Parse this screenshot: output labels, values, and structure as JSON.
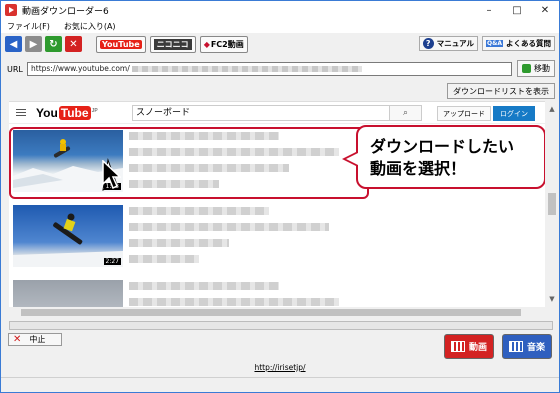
{
  "window": {
    "title": "動画ダウンローダー6",
    "controls": {
      "minimize": "–",
      "maximize": "□",
      "close": "✕"
    }
  },
  "menu": {
    "items": [
      "ファイル(F)",
      "お気に入り(A)"
    ]
  },
  "toolbar": {
    "site_buttons": [
      "YouTube",
      "ニコニコ",
      "FC2動画"
    ],
    "manual_label": "マニュアル",
    "faq_label": "よくある質問",
    "faq_badge": "Q&A"
  },
  "url_bar": {
    "label": "URL",
    "value": "https://www.youtube.com/",
    "go_label": "移動"
  },
  "download_list_label": "ダウンロードリストを表示",
  "youtube": {
    "logo_you": "You",
    "logo_tube": "Tube",
    "logo_jp": "JP",
    "search_value": "スノーボード",
    "upload_label": "アップロード",
    "login_label": "ログイン",
    "videos": [
      {
        "duration": "1:53"
      },
      {
        "duration": "2:27"
      },
      {
        "duration": ""
      }
    ]
  },
  "callout": {
    "line1": "ダウンロードしたい",
    "line2": "動画を選択！"
  },
  "stop_label": "中止",
  "download_video_label": "動画",
  "download_audio_label": "音楽",
  "footer_link": "http://irisetjp/",
  "colors": {
    "accent_red": "#c8102e",
    "login_blue": "#167ac6",
    "video_btn": "#d32222",
    "audio_btn": "#2f5fbf"
  }
}
